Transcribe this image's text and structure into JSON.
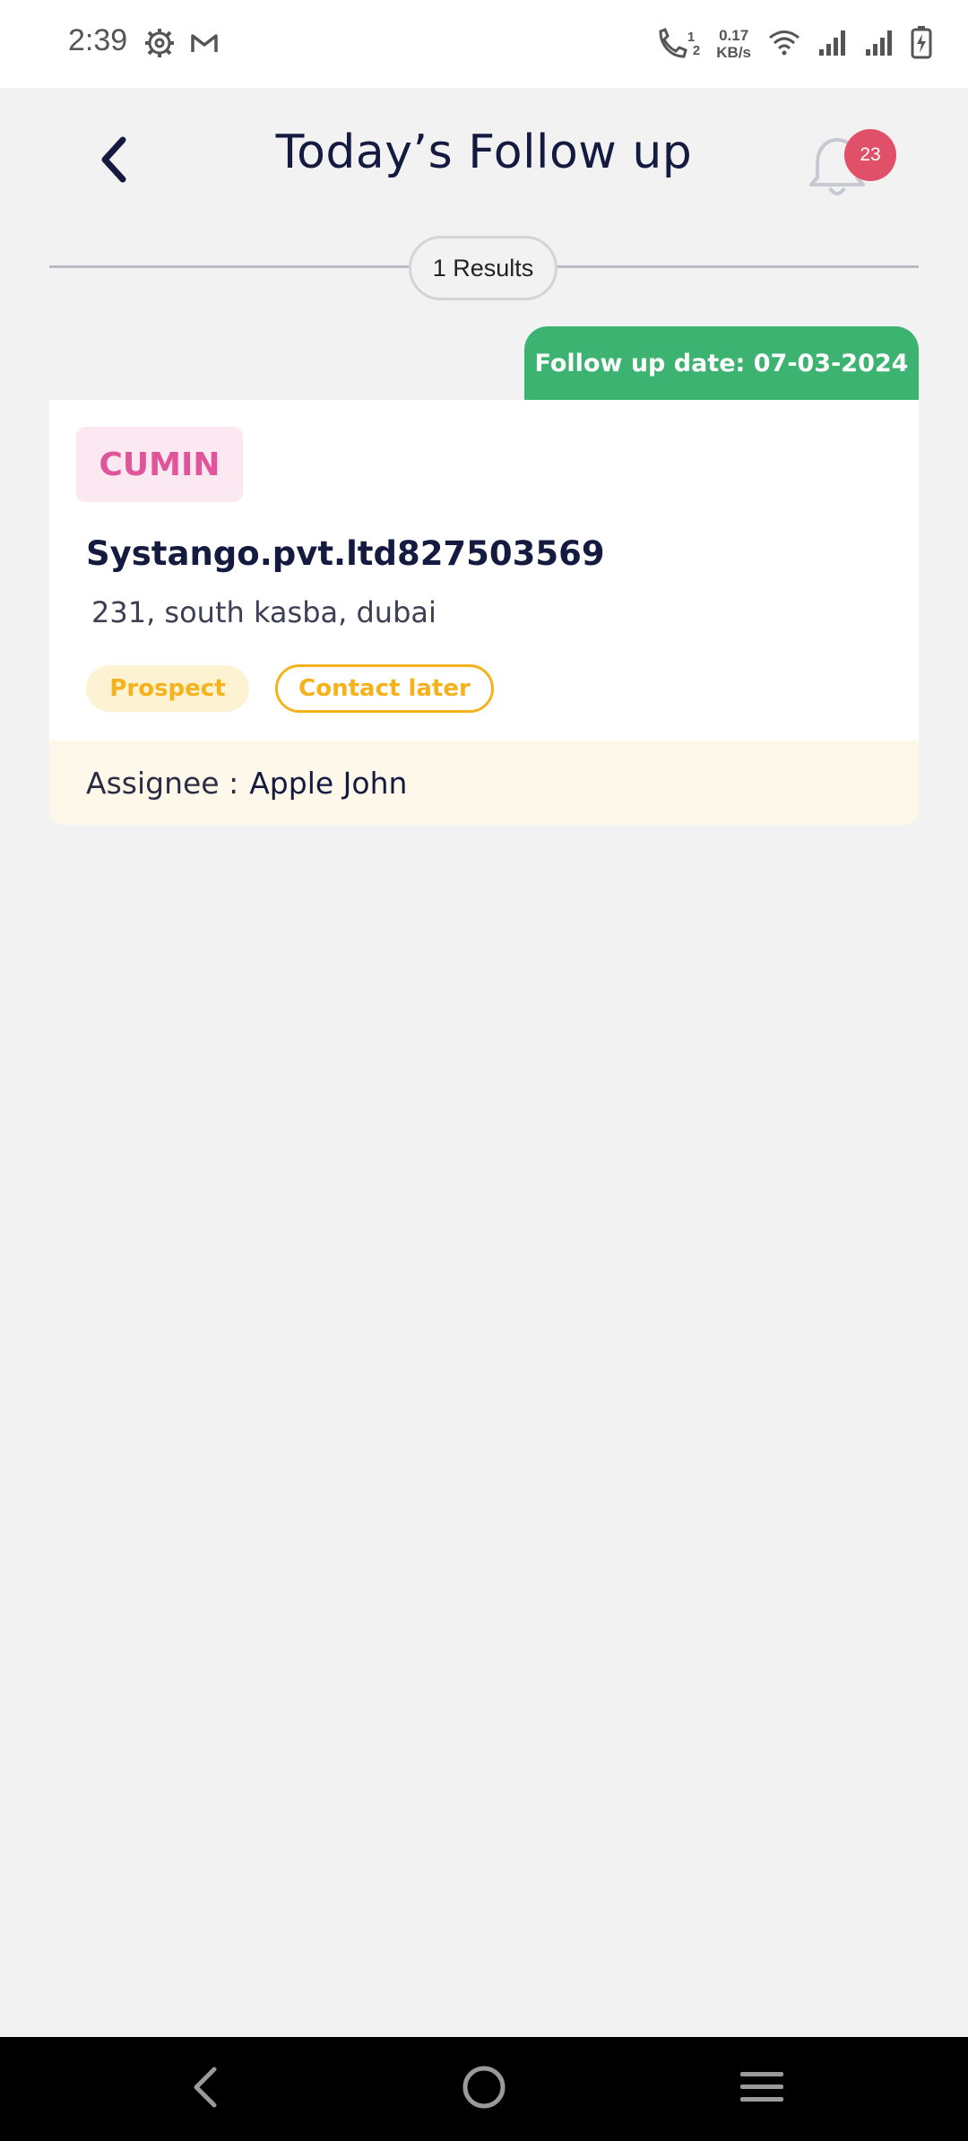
{
  "status_bar": {
    "time": "2:39",
    "net_speed_value": "0.17",
    "net_speed_unit": "KB/s",
    "call_sim_1": "1",
    "call_sim_2": "2"
  },
  "header": {
    "title": "Today’s Follow up",
    "notification_count": "23"
  },
  "results": {
    "label": "1 Results"
  },
  "followups": [
    {
      "date_label": "Follow up date: 07-03-2024",
      "category": "CUMIN",
      "company": "Systango.pvt.ltd827503569",
      "address": "231, south kasba, dubai",
      "status_tag": "Prospect",
      "action_tag": "Contact later",
      "assignee_label": "Assignee :",
      "assignee_name": "Apple John"
    }
  ],
  "colors": {
    "accent_green": "#3cb371",
    "badge_red": "#e05068",
    "category_pink": "#e0559a",
    "tag_amber": "#f5b21a",
    "title_navy": "#141a40"
  },
  "icons": {
    "back": "chevron-left-icon",
    "notifications": "bell-icon",
    "nav_back": "nav-back-icon",
    "nav_home": "nav-home-icon",
    "nav_recents": "nav-recents-icon"
  }
}
